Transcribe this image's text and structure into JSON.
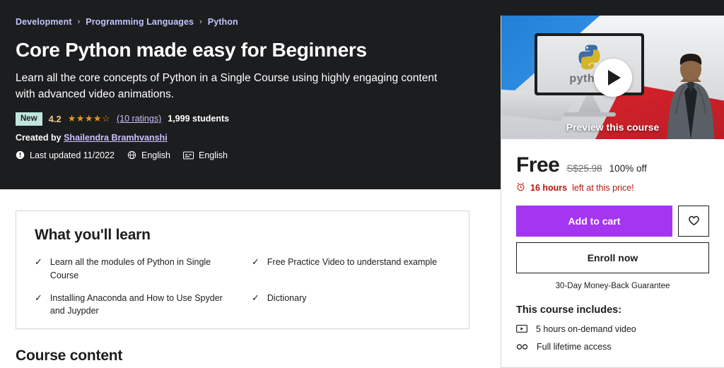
{
  "breadcrumb": {
    "separator": "›",
    "items": [
      "Development",
      "Programming Languages",
      "Python"
    ]
  },
  "course": {
    "title": "Core Python made easy for Beginners",
    "subtitle": "Learn all the core concepts of Python in a Single Course using highly engaging content with advanced video animations.",
    "badge_new": "New",
    "rating_value": "4.2",
    "stars_glyphs": "★★★★☆",
    "ratings_link": "(10 ratings)",
    "students": "1,999 students",
    "created_by_label": "Created by",
    "instructor": "Shailendra Bramhvanshi",
    "meta": [
      {
        "icon": "exclamation-circle-icon",
        "text": "Last updated 11/2022"
      },
      {
        "icon": "globe-icon",
        "text": "English"
      },
      {
        "icon": "closed-caption-icon",
        "text": "English"
      }
    ]
  },
  "what_you_learn": {
    "title": "What you'll learn",
    "check_glyph": "✓",
    "items": [
      "Learn all the modules of Python in Single Course",
      "Free Practice Video to understand example",
      "Installing Anaconda and How to Use Spyder and Juypder",
      "Dictionary"
    ]
  },
  "course_content": {
    "title": "Course content"
  },
  "sidebar": {
    "preview": {
      "label": "Preview this course",
      "screen_text": "python",
      "play_icon": "play-icon"
    },
    "price": {
      "current": "Free",
      "original": "S$25.98",
      "discount": "100% off"
    },
    "deadline": {
      "icon": "alarm-clock-icon",
      "highlight": "16 hours",
      "rest": "left at this price!"
    },
    "buttons": {
      "add_to_cart": "Add to cart",
      "wishlist_icon": "heart-icon",
      "enroll": "Enroll now"
    },
    "guarantee": "30-Day Money-Back Guarantee",
    "includes_title": "This course includes:",
    "includes": [
      {
        "icon": "video-icon",
        "text": "5 hours on-demand video"
      },
      {
        "icon": "infinity-icon",
        "text": "Full lifetime access"
      }
    ]
  },
  "colors": {
    "hero_bg": "#1c1d1f",
    "accent_purple": "#a435f0",
    "link_purple": "#cec0fc",
    "star_gold": "#e59819",
    "badge_teal": "#c0e5dd",
    "deadline_red": "#b4170f"
  }
}
